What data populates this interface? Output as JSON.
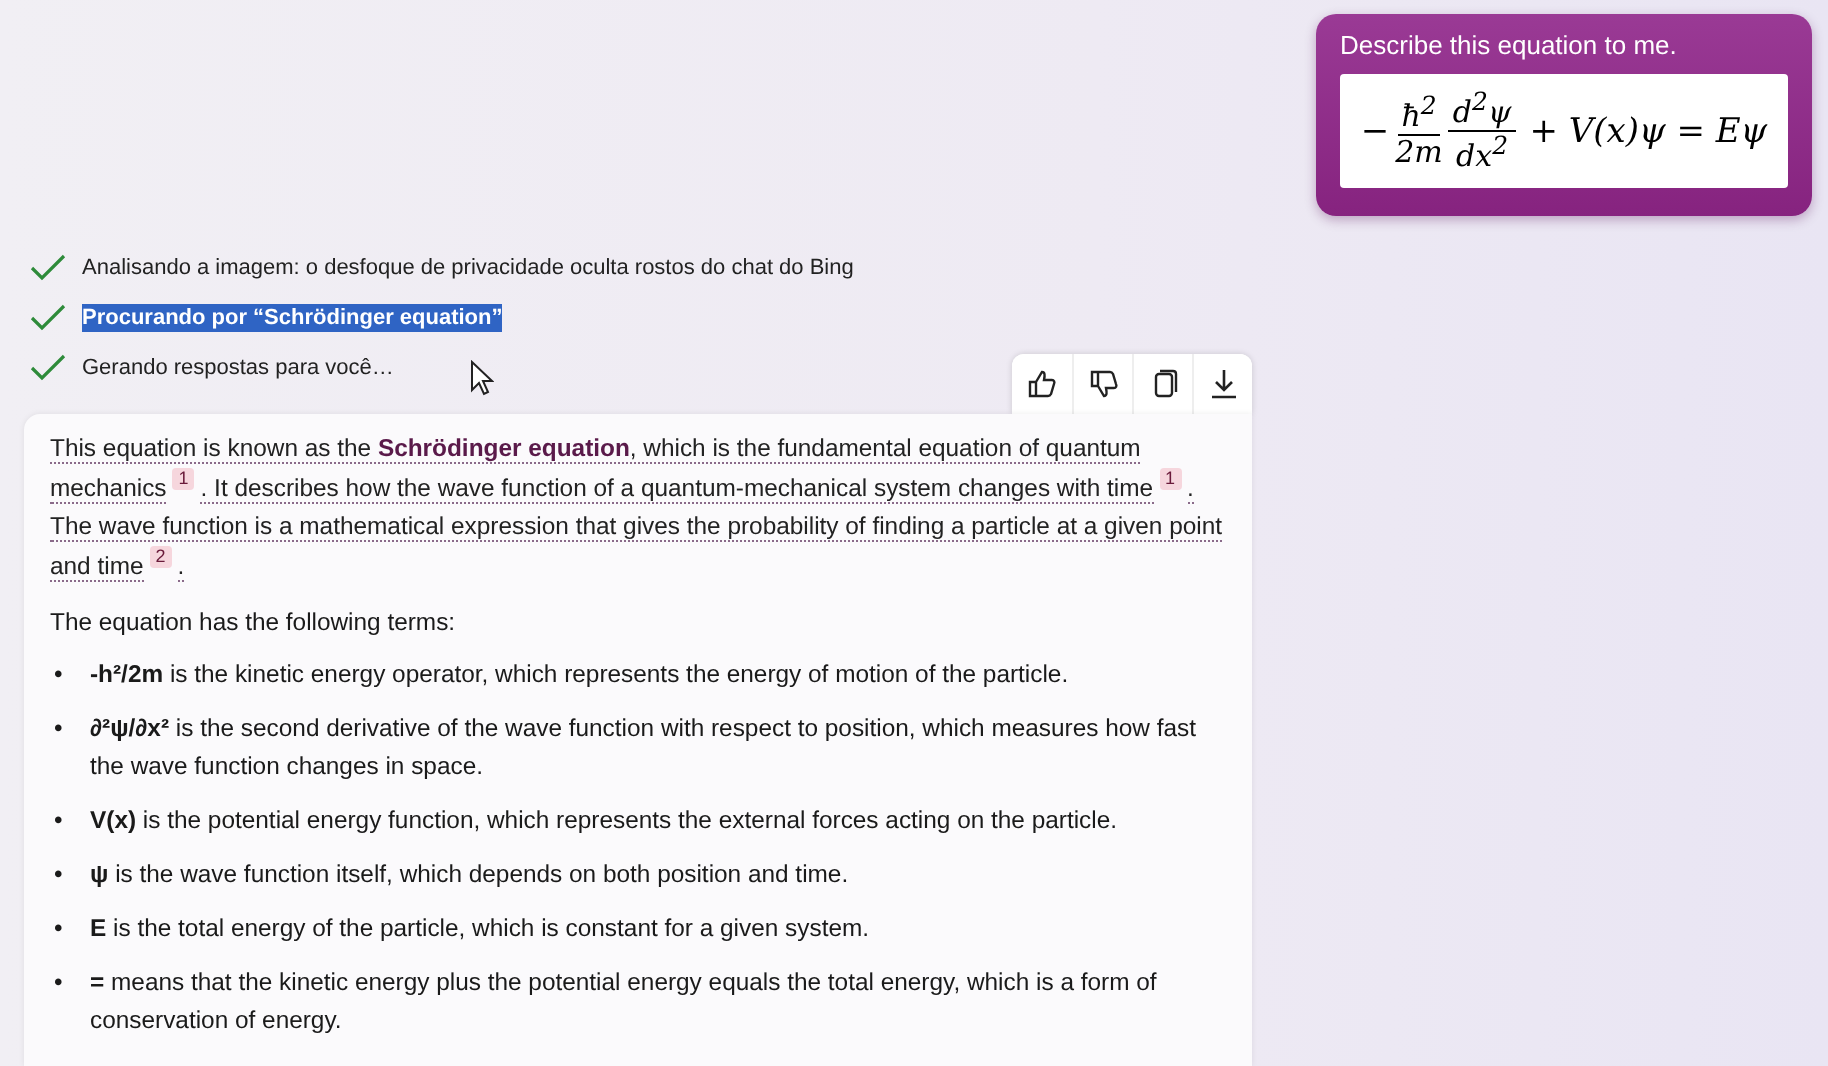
{
  "user_message": {
    "text": "Describe this equation to me.",
    "equation": {
      "sign": "−",
      "fractions": [
        {
          "num": "ħ$^{2}$",
          "den": "2m"
        },
        {
          "num": "d$^{2}$ψ",
          "den": "dx$^{2}$"
        }
      ],
      "rest": "+ V(x)ψ = Eψ"
    }
  },
  "steps": [
    {
      "text": "Analisando a imagem: o desfoque de privacidade oculta rostos do chat do Bing",
      "checked": true,
      "highlighted": false
    },
    {
      "text": "Procurando por “Schrödinger equation”",
      "checked": true,
      "highlighted": true
    },
    {
      "text": "Gerando respostas para você…",
      "checked": true,
      "highlighted": false
    }
  ],
  "actions": [
    {
      "kind": "like"
    },
    {
      "kind": "dislike"
    },
    {
      "kind": "copy"
    },
    {
      "kind": "download"
    }
  ],
  "answer": {
    "intro": [
      {
        "kind": "text",
        "text": "This equation is known as the **Schrödinger equation**, which is the fundamental equation of quantum mechanics"
      },
      {
        "kind": "cite",
        "text": "1"
      },
      {
        "kind": "text",
        "text": ". It describes how the wave function of a quantum-mechanical system changes with time"
      },
      {
        "kind": "cite",
        "text": "1"
      },
      {
        "kind": "text",
        "text": ". The wave function is a mathematical expression that gives the probability of finding a particle at a given point and time"
      },
      {
        "kind": "cite",
        "text": "2"
      },
      {
        "kind": "text",
        "text": "."
      }
    ],
    "lead": "The equation has the following terms:",
    "terms": [
      {
        "bullet": "•",
        "text": "**-h²/2m** is the kinetic energy operator, which represents the energy of motion of the particle."
      },
      {
        "bullet": "•",
        "text": "**∂²ψ/∂x²** is the second derivative of the wave function with respect to position, which measures how fast the wave function changes in space."
      },
      {
        "bullet": "•",
        "text": "**V(x)** is the potential energy function, which represents the external forces acting on the particle."
      },
      {
        "bullet": "•",
        "text": "**ψ** is the wave function itself, which depends on both position and time."
      },
      {
        "bullet": "•",
        "text": "**E** is the total energy of the particle, which is constant for a given system."
      },
      {
        "bullet": "•",
        "text": "**=** means that the kinetic energy plus the potential energy equals the total energy, which is a form of conservation of energy."
      }
    ]
  }
}
